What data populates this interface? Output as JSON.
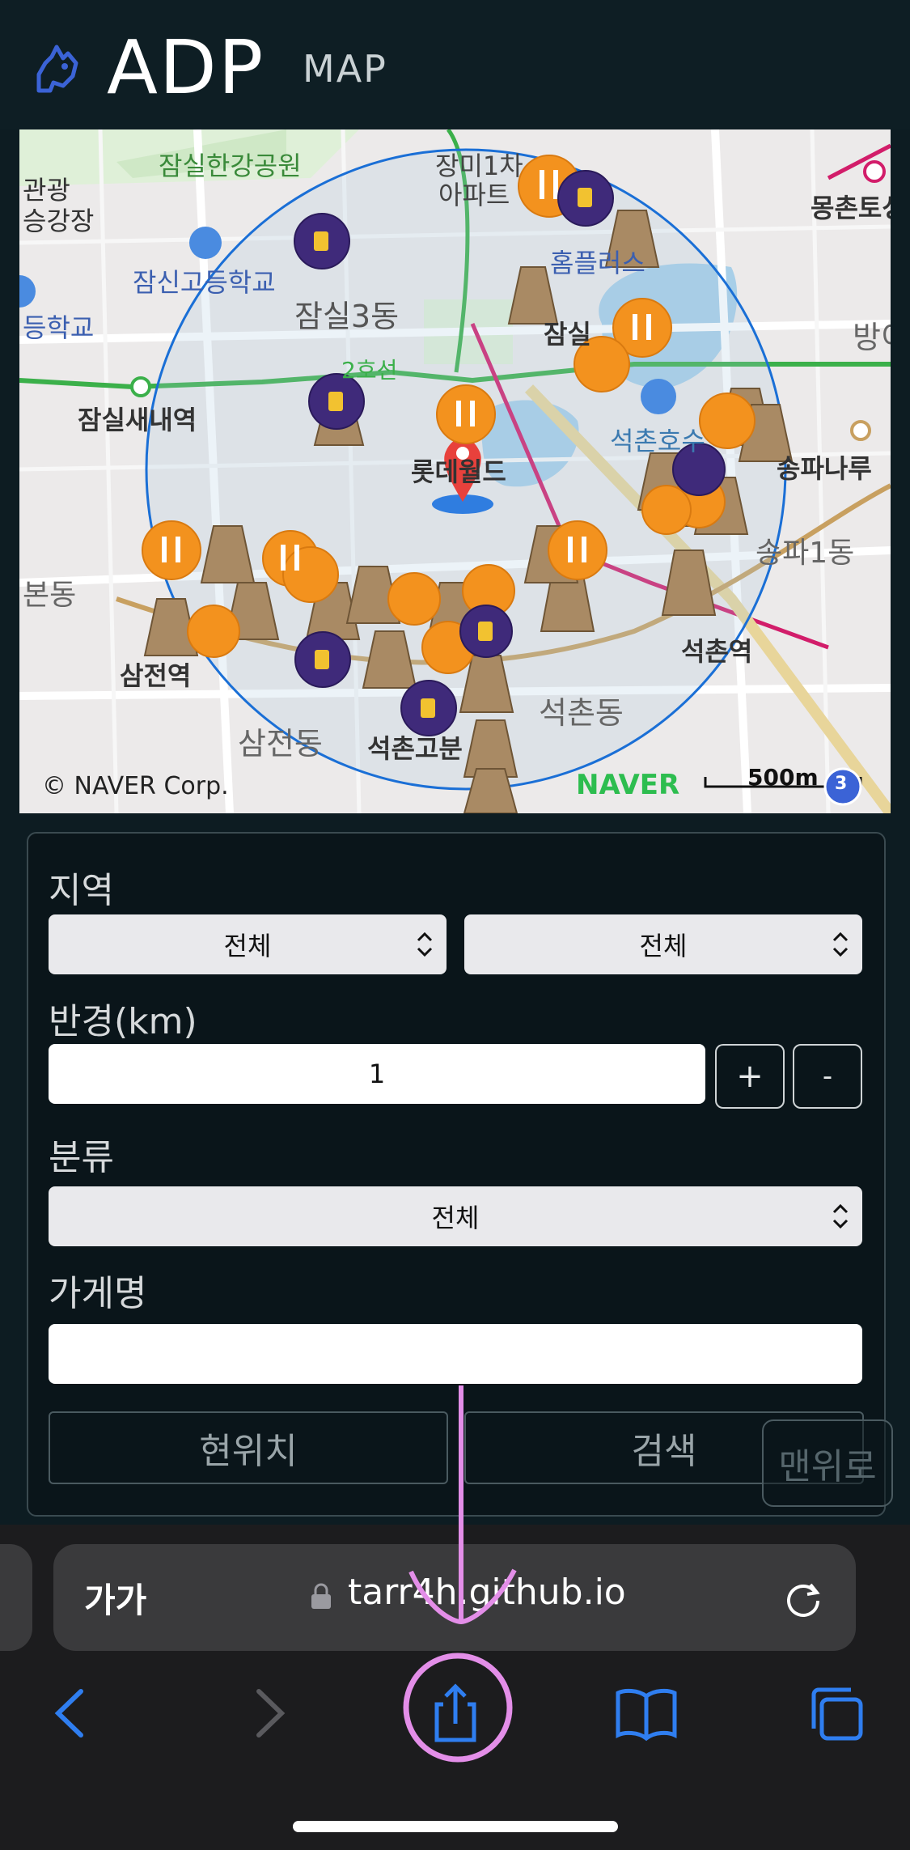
{
  "header": {
    "brand": "ADP",
    "subtitle": "MAP",
    "logo_icon": "dog-icon"
  },
  "map": {
    "labels": [
      {
        "text": "잠실한강공원"
      },
      {
        "text": "장미1차"
      },
      {
        "text": "아파트"
      },
      {
        "text": "몽촌토성"
      },
      {
        "text": "관광"
      },
      {
        "text": "승강장"
      },
      {
        "text": "잠신고등학교"
      },
      {
        "text": "잠실3동"
      },
      {
        "text": "등학교"
      },
      {
        "text": "홈플러스"
      },
      {
        "text": "잠실"
      },
      {
        "text": "방이"
      },
      {
        "text": "2호선"
      },
      {
        "text": "잠실새내역"
      },
      {
        "text": "롯데월드"
      },
      {
        "text": "석촌호수"
      },
      {
        "text": "송파나루"
      },
      {
        "text": "송파1동"
      },
      {
        "text": "본동"
      },
      {
        "text": "삼전역"
      },
      {
        "text": "석촌역"
      },
      {
        "text": "삼전동"
      },
      {
        "text": "석촌고분"
      },
      {
        "text": "석촌동"
      }
    ],
    "copyright": "© NAVER Corp.",
    "provider": "NAVER",
    "scale": "500m",
    "line_badge": "3"
  },
  "form": {
    "region_label": "지역",
    "region1_value": "전체",
    "region2_value": "전체",
    "radius_label": "반경(km)",
    "radius_value": "1",
    "plus_label": "+",
    "minus_label": "-",
    "category_label": "분류",
    "category_value": "전체",
    "store_label": "가게명",
    "store_value": "",
    "location_button": "현위치",
    "search_button": "검색",
    "top_button": "맨위로"
  },
  "browser": {
    "aa": "가가",
    "url": "tarr4h.github.io",
    "toolbar": [
      "back-icon",
      "forward-icon",
      "share-icon",
      "bookmarks-icon",
      "tabs-icon"
    ]
  },
  "colors": {
    "background": "#0d1c22",
    "accent": "#2f6fe8",
    "annotation": "#e38ee8",
    "marker_orange": "#f3921e",
    "marker_purple": "#3f2a7a"
  }
}
